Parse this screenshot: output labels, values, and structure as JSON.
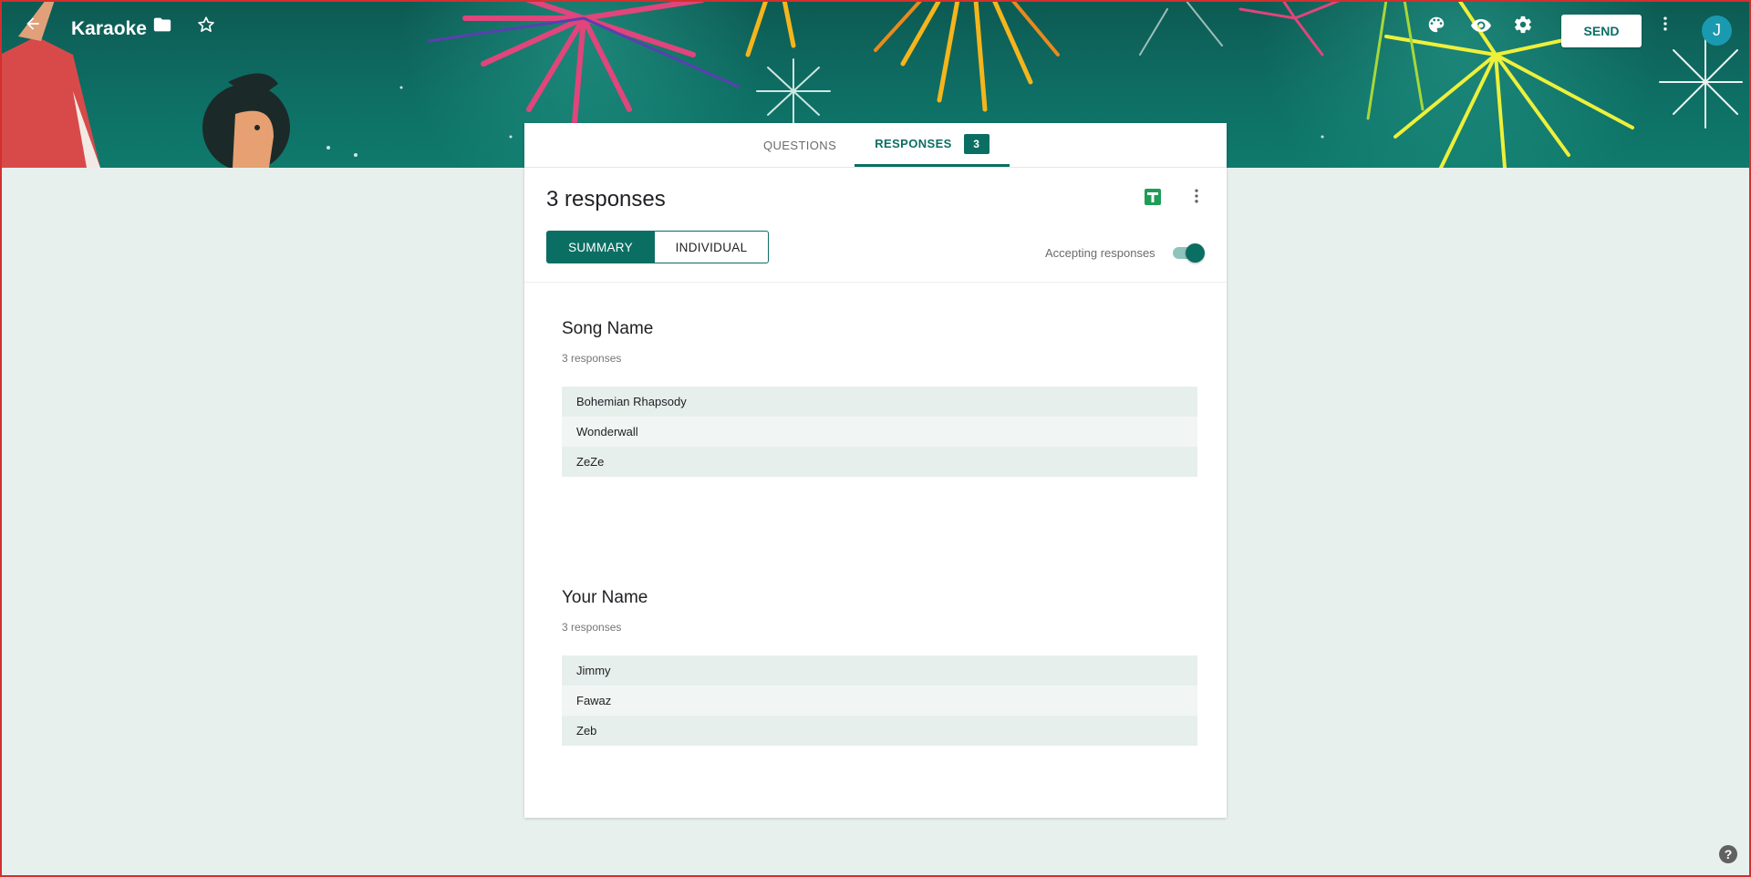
{
  "header": {
    "title": "Karaoke",
    "send_label": "SEND",
    "avatar_initial": "J",
    "icons": [
      "arrow-back-icon",
      "folder-icon",
      "star-icon",
      "palette-icon",
      "eye-icon",
      "gear-icon",
      "more-vert-icon"
    ]
  },
  "tabs": {
    "questions": "QUESTIONS",
    "responses": "RESPONSES",
    "responses_badge": "3"
  },
  "responses": {
    "count_label": "3 responses",
    "summary_label": "SUMMARY",
    "individual_label": "INDIVIDUAL",
    "accepting_label": "Accepting responses",
    "accepting_on": true
  },
  "questions": [
    {
      "title": "Song Name",
      "subtitle": "3 responses",
      "answers": [
        "Bohemian Rhapsody",
        "Wonderwall",
        "ZeZe"
      ]
    },
    {
      "title": "Your Name",
      "subtitle": "3 responses",
      "answers": [
        "Jimmy",
        "Fawaz",
        "Zeb"
      ]
    }
  ],
  "help_label": "?",
  "colors": {
    "accent": "#0b6e63",
    "page_bg": "#e8f0ee",
    "banner_bg": "#0e6e64"
  }
}
